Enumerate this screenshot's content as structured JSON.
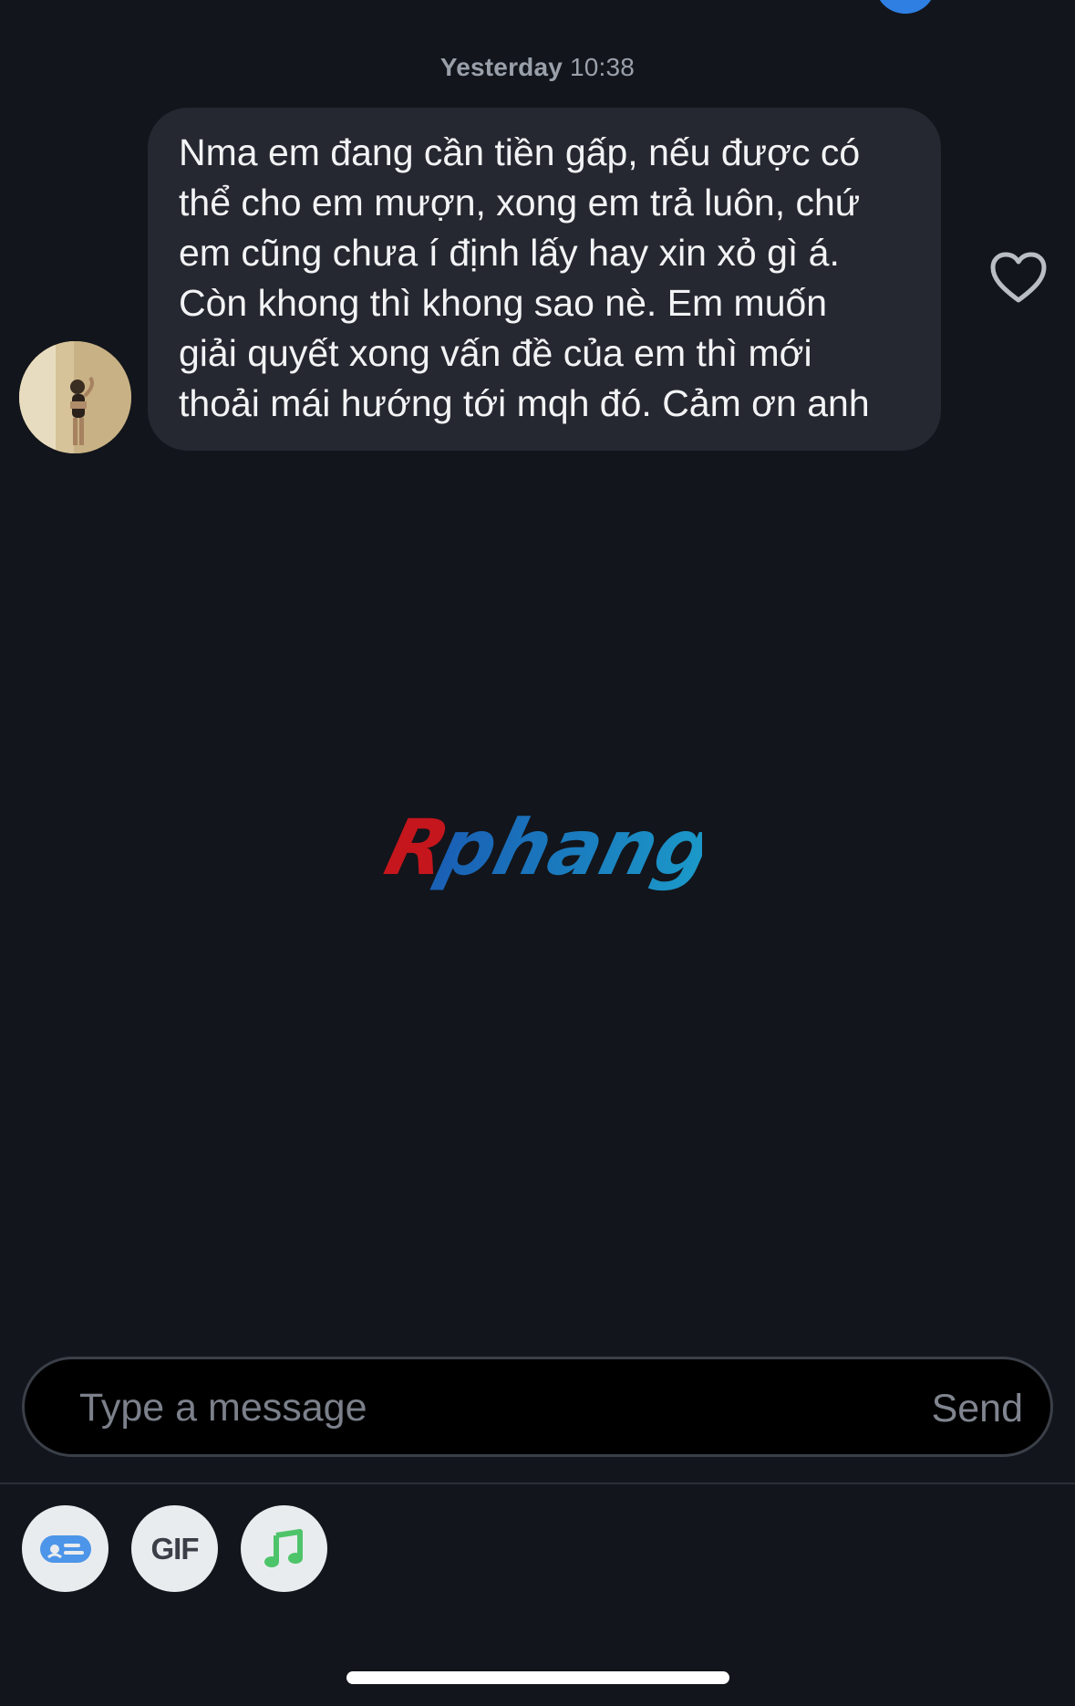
{
  "conversation": {
    "timestamp_day": "Yesterday",
    "timestamp_time": "10:38",
    "message": {
      "lines": [
        "Nma em đang cần tiền gấp, nếu được có",
        "thể cho em mượn, xong em trả luôn, chứ",
        "em cũng chưa í định lấy hay xin xỏ gì á.",
        "Còn khong thì khong sao nè. Em muốn",
        "giải quyết xong vấn đề của em thì mới",
        "thoải mái hướng tới mqh đó. Cảm ơn anh"
      ],
      "liked": false
    }
  },
  "watermark": {
    "text": "Rphang",
    "colors": [
      "#c4161c",
      "#1a5fb4",
      "#1b9ac9"
    ]
  },
  "composer": {
    "placeholder": "Type a message",
    "value": "",
    "send_label": "Send"
  },
  "toolbar": {
    "items": [
      {
        "icon": "card-icon",
        "color": "#4c95e8"
      },
      {
        "label": "GIF"
      },
      {
        "icon": "music-note-icon",
        "color": "#4ec46a"
      }
    ]
  },
  "colors": {
    "background": "#12151b",
    "bubble": "#252830",
    "accent": "#2f7fe3"
  }
}
